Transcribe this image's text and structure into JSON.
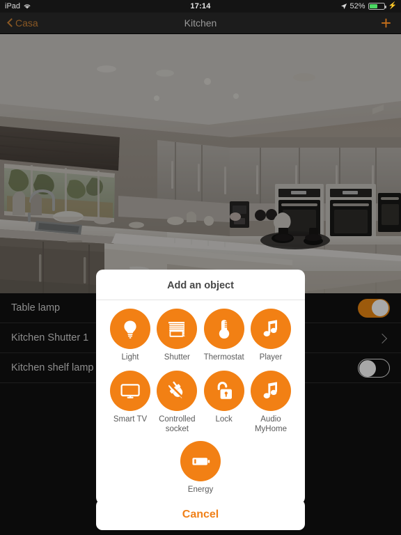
{
  "status_bar": {
    "device": "iPad",
    "wifi_icon": "wifi-icon",
    "time": "17:14",
    "location_icon": "location-arrow-icon",
    "battery_percent": "52%",
    "battery_icon": "battery-charging-icon",
    "battery_level": 52,
    "battery_color": "#4cd964"
  },
  "nav_bar": {
    "back_icon": "chevron-left-icon",
    "back_label": "Casa",
    "title": "Kitchen",
    "add_icon": "plus-icon",
    "tint_color": "#f08018"
  },
  "photo": {
    "alt_name": "kitchen-photo"
  },
  "device_list": {
    "rows": [
      {
        "label": "Table lamp",
        "control": "toggle",
        "state": "on"
      },
      {
        "label": "Kitchen Shutter 1",
        "control": "chevron",
        "state": ""
      },
      {
        "label": "Kitchen shelf lamp",
        "control": "toggle",
        "state": "off"
      }
    ]
  },
  "dialog": {
    "title": "Add an object",
    "items": [
      {
        "label": "Light",
        "icon": "lightbulb-icon"
      },
      {
        "label": "Shutter",
        "icon": "window-blind-icon"
      },
      {
        "label": "Thermostat",
        "icon": "thermometer-icon"
      },
      {
        "label": "Player",
        "icon": "music-note-icon"
      },
      {
        "label": "Smart TV",
        "icon": "television-icon"
      },
      {
        "label": "Controlled socket",
        "icon": "power-plug-icon"
      },
      {
        "label": "Lock",
        "icon": "open-padlock-icon"
      },
      {
        "label": "Audio MyHome",
        "icon": "music-note-icon"
      },
      {
        "label": "Energy",
        "icon": "battery-icon"
      }
    ],
    "accent_color": "#f28014"
  },
  "cancel_button": {
    "label": "Cancel",
    "color": "#f08018"
  }
}
